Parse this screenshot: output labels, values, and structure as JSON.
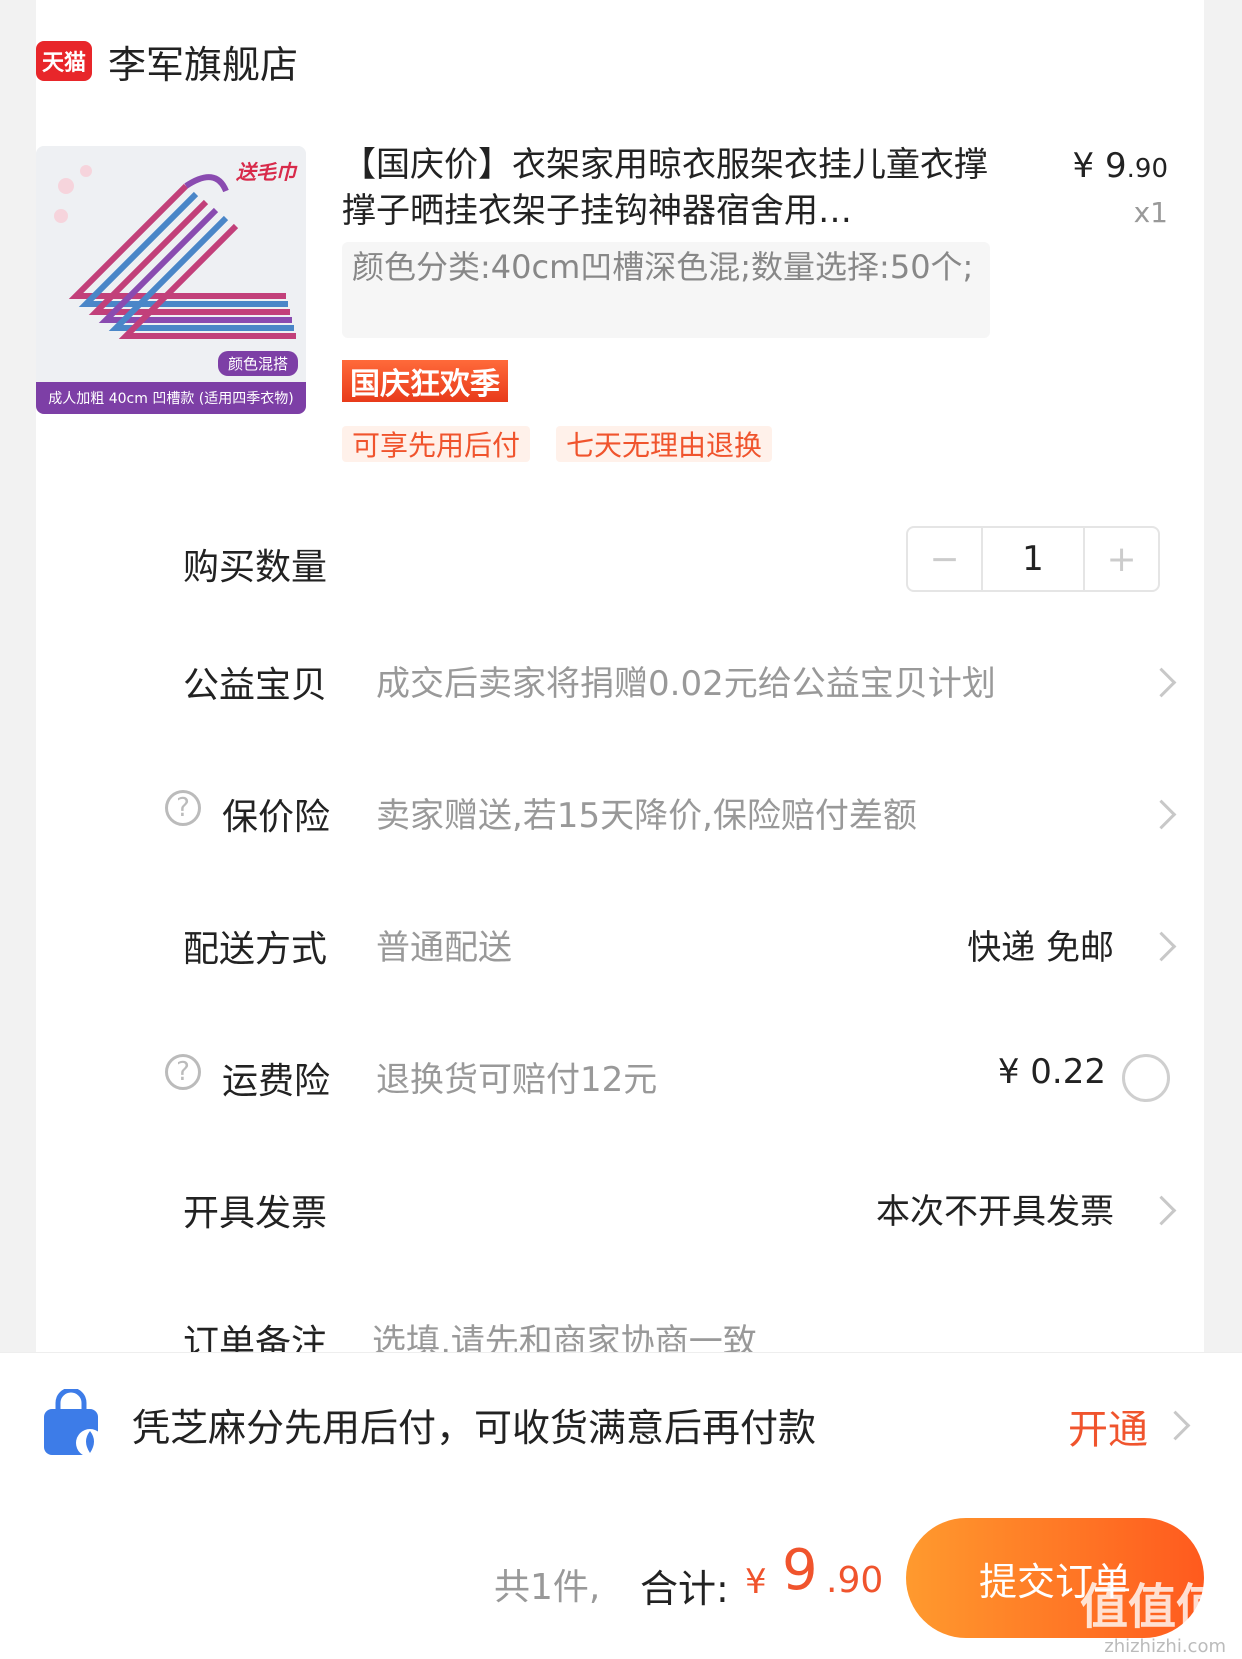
{
  "store": {
    "logo_text": "天猫",
    "name": "李军旗舰店"
  },
  "product": {
    "image_tags": {
      "top": "送毛巾",
      "mid": "颜色混搭",
      "bottom": "成人加粗 40cm 凹槽款 (适用四季衣物)"
    },
    "title": "【国庆价】衣架家用晾衣服架衣挂儿童衣撑撑子晒挂衣架子挂钩神器宿舍用…",
    "price_symbol": "¥",
    "price_int": "9",
    "price_dec": ".90",
    "quantity_label": "x1",
    "sku": "颜色分类:40cm凹槽深色混;数量选择:50个;",
    "promo_badge": "国庆狂欢季",
    "tags": [
      "可享先用后付",
      "七天无理由退换"
    ]
  },
  "rows": {
    "quantity": {
      "label": "购买数量",
      "minus": "−",
      "value": "1",
      "plus": "+"
    },
    "charity": {
      "label": "公益宝贝",
      "value": "成交后卖家将捐赠0.02元给公益宝贝计划"
    },
    "price_protect": {
      "label": "保价险",
      "value": "卖家赠送,若15天降价,保险赔付差额"
    },
    "delivery": {
      "label": "配送方式",
      "value": "普通配送",
      "right": "快递 免邮"
    },
    "shipping_insurance": {
      "label": "运费险",
      "value": "退换货可赔付12元",
      "right": "¥ 0.22"
    },
    "invoice": {
      "label": "开具发票",
      "right": "本次不开具发票"
    },
    "note": {
      "label": "订单备注",
      "placeholder": "选填,请先和商家协商一致"
    }
  },
  "banner": {
    "text": "凭芝麻分先用后付，可收货满意后再付款",
    "cta": "开通"
  },
  "footer": {
    "count_text": "共1件,",
    "total_label": "合计:",
    "total_symbol": "¥",
    "total_int": "9",
    "total_dec": ".90",
    "submit_label": "提交订单"
  },
  "watermark": {
    "text": "值值值",
    "url": "zhizhizhi.com"
  },
  "colors": {
    "accent": "#f0542d",
    "tmall_red": "#e8262a"
  }
}
